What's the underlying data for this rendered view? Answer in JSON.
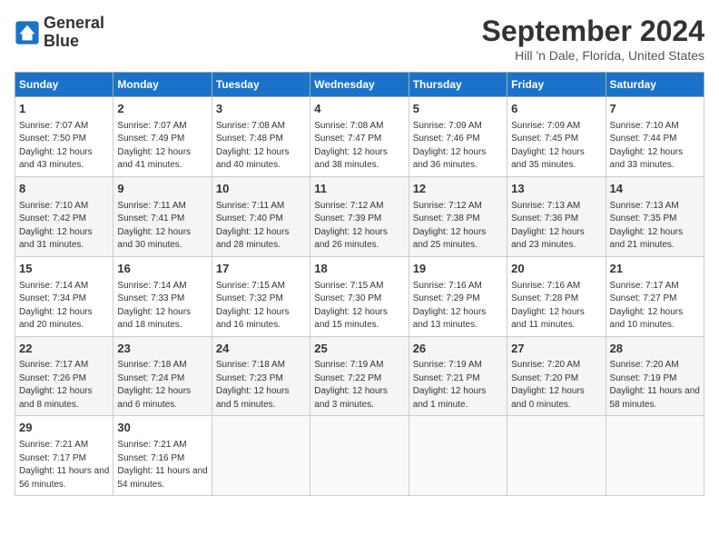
{
  "logo": {
    "line1": "General",
    "line2": "Blue"
  },
  "title": "September 2024",
  "subtitle": "Hill 'n Dale, Florida, United States",
  "days_header": [
    "Sunday",
    "Monday",
    "Tuesday",
    "Wednesday",
    "Thursday",
    "Friday",
    "Saturday"
  ],
  "weeks": [
    [
      {
        "day": "1",
        "sunrise": "Sunrise: 7:07 AM",
        "sunset": "Sunset: 7:50 PM",
        "daylight": "Daylight: 12 hours and 43 minutes."
      },
      {
        "day": "2",
        "sunrise": "Sunrise: 7:07 AM",
        "sunset": "Sunset: 7:49 PM",
        "daylight": "Daylight: 12 hours and 41 minutes."
      },
      {
        "day": "3",
        "sunrise": "Sunrise: 7:08 AM",
        "sunset": "Sunset: 7:48 PM",
        "daylight": "Daylight: 12 hours and 40 minutes."
      },
      {
        "day": "4",
        "sunrise": "Sunrise: 7:08 AM",
        "sunset": "Sunset: 7:47 PM",
        "daylight": "Daylight: 12 hours and 38 minutes."
      },
      {
        "day": "5",
        "sunrise": "Sunrise: 7:09 AM",
        "sunset": "Sunset: 7:46 PM",
        "daylight": "Daylight: 12 hours and 36 minutes."
      },
      {
        "day": "6",
        "sunrise": "Sunrise: 7:09 AM",
        "sunset": "Sunset: 7:45 PM",
        "daylight": "Daylight: 12 hours and 35 minutes."
      },
      {
        "day": "7",
        "sunrise": "Sunrise: 7:10 AM",
        "sunset": "Sunset: 7:44 PM",
        "daylight": "Daylight: 12 hours and 33 minutes."
      }
    ],
    [
      {
        "day": "8",
        "sunrise": "Sunrise: 7:10 AM",
        "sunset": "Sunset: 7:42 PM",
        "daylight": "Daylight: 12 hours and 31 minutes."
      },
      {
        "day": "9",
        "sunrise": "Sunrise: 7:11 AM",
        "sunset": "Sunset: 7:41 PM",
        "daylight": "Daylight: 12 hours and 30 minutes."
      },
      {
        "day": "10",
        "sunrise": "Sunrise: 7:11 AM",
        "sunset": "Sunset: 7:40 PM",
        "daylight": "Daylight: 12 hours and 28 minutes."
      },
      {
        "day": "11",
        "sunrise": "Sunrise: 7:12 AM",
        "sunset": "Sunset: 7:39 PM",
        "daylight": "Daylight: 12 hours and 26 minutes."
      },
      {
        "day": "12",
        "sunrise": "Sunrise: 7:12 AM",
        "sunset": "Sunset: 7:38 PM",
        "daylight": "Daylight: 12 hours and 25 minutes."
      },
      {
        "day": "13",
        "sunrise": "Sunrise: 7:13 AM",
        "sunset": "Sunset: 7:36 PM",
        "daylight": "Daylight: 12 hours and 23 minutes."
      },
      {
        "day": "14",
        "sunrise": "Sunrise: 7:13 AM",
        "sunset": "Sunset: 7:35 PM",
        "daylight": "Daylight: 12 hours and 21 minutes."
      }
    ],
    [
      {
        "day": "15",
        "sunrise": "Sunrise: 7:14 AM",
        "sunset": "Sunset: 7:34 PM",
        "daylight": "Daylight: 12 hours and 20 minutes."
      },
      {
        "day": "16",
        "sunrise": "Sunrise: 7:14 AM",
        "sunset": "Sunset: 7:33 PM",
        "daylight": "Daylight: 12 hours and 18 minutes."
      },
      {
        "day": "17",
        "sunrise": "Sunrise: 7:15 AM",
        "sunset": "Sunset: 7:32 PM",
        "daylight": "Daylight: 12 hours and 16 minutes."
      },
      {
        "day": "18",
        "sunrise": "Sunrise: 7:15 AM",
        "sunset": "Sunset: 7:30 PM",
        "daylight": "Daylight: 12 hours and 15 minutes."
      },
      {
        "day": "19",
        "sunrise": "Sunrise: 7:16 AM",
        "sunset": "Sunset: 7:29 PM",
        "daylight": "Daylight: 12 hours and 13 minutes."
      },
      {
        "day": "20",
        "sunrise": "Sunrise: 7:16 AM",
        "sunset": "Sunset: 7:28 PM",
        "daylight": "Daylight: 12 hours and 11 minutes."
      },
      {
        "day": "21",
        "sunrise": "Sunrise: 7:17 AM",
        "sunset": "Sunset: 7:27 PM",
        "daylight": "Daylight: 12 hours and 10 minutes."
      }
    ],
    [
      {
        "day": "22",
        "sunrise": "Sunrise: 7:17 AM",
        "sunset": "Sunset: 7:26 PM",
        "daylight": "Daylight: 12 hours and 8 minutes."
      },
      {
        "day": "23",
        "sunrise": "Sunrise: 7:18 AM",
        "sunset": "Sunset: 7:24 PM",
        "daylight": "Daylight: 12 hours and 6 minutes."
      },
      {
        "day": "24",
        "sunrise": "Sunrise: 7:18 AM",
        "sunset": "Sunset: 7:23 PM",
        "daylight": "Daylight: 12 hours and 5 minutes."
      },
      {
        "day": "25",
        "sunrise": "Sunrise: 7:19 AM",
        "sunset": "Sunset: 7:22 PM",
        "daylight": "Daylight: 12 hours and 3 minutes."
      },
      {
        "day": "26",
        "sunrise": "Sunrise: 7:19 AM",
        "sunset": "Sunset: 7:21 PM",
        "daylight": "Daylight: 12 hours and 1 minute."
      },
      {
        "day": "27",
        "sunrise": "Sunrise: 7:20 AM",
        "sunset": "Sunset: 7:20 PM",
        "daylight": "Daylight: 12 hours and 0 minutes."
      },
      {
        "day": "28",
        "sunrise": "Sunrise: 7:20 AM",
        "sunset": "Sunset: 7:19 PM",
        "daylight": "Daylight: 11 hours and 58 minutes."
      }
    ],
    [
      {
        "day": "29",
        "sunrise": "Sunrise: 7:21 AM",
        "sunset": "Sunset: 7:17 PM",
        "daylight": "Daylight: 11 hours and 56 minutes."
      },
      {
        "day": "30",
        "sunrise": "Sunrise: 7:21 AM",
        "sunset": "Sunset: 7:16 PM",
        "daylight": "Daylight: 11 hours and 54 minutes."
      },
      null,
      null,
      null,
      null,
      null
    ]
  ]
}
